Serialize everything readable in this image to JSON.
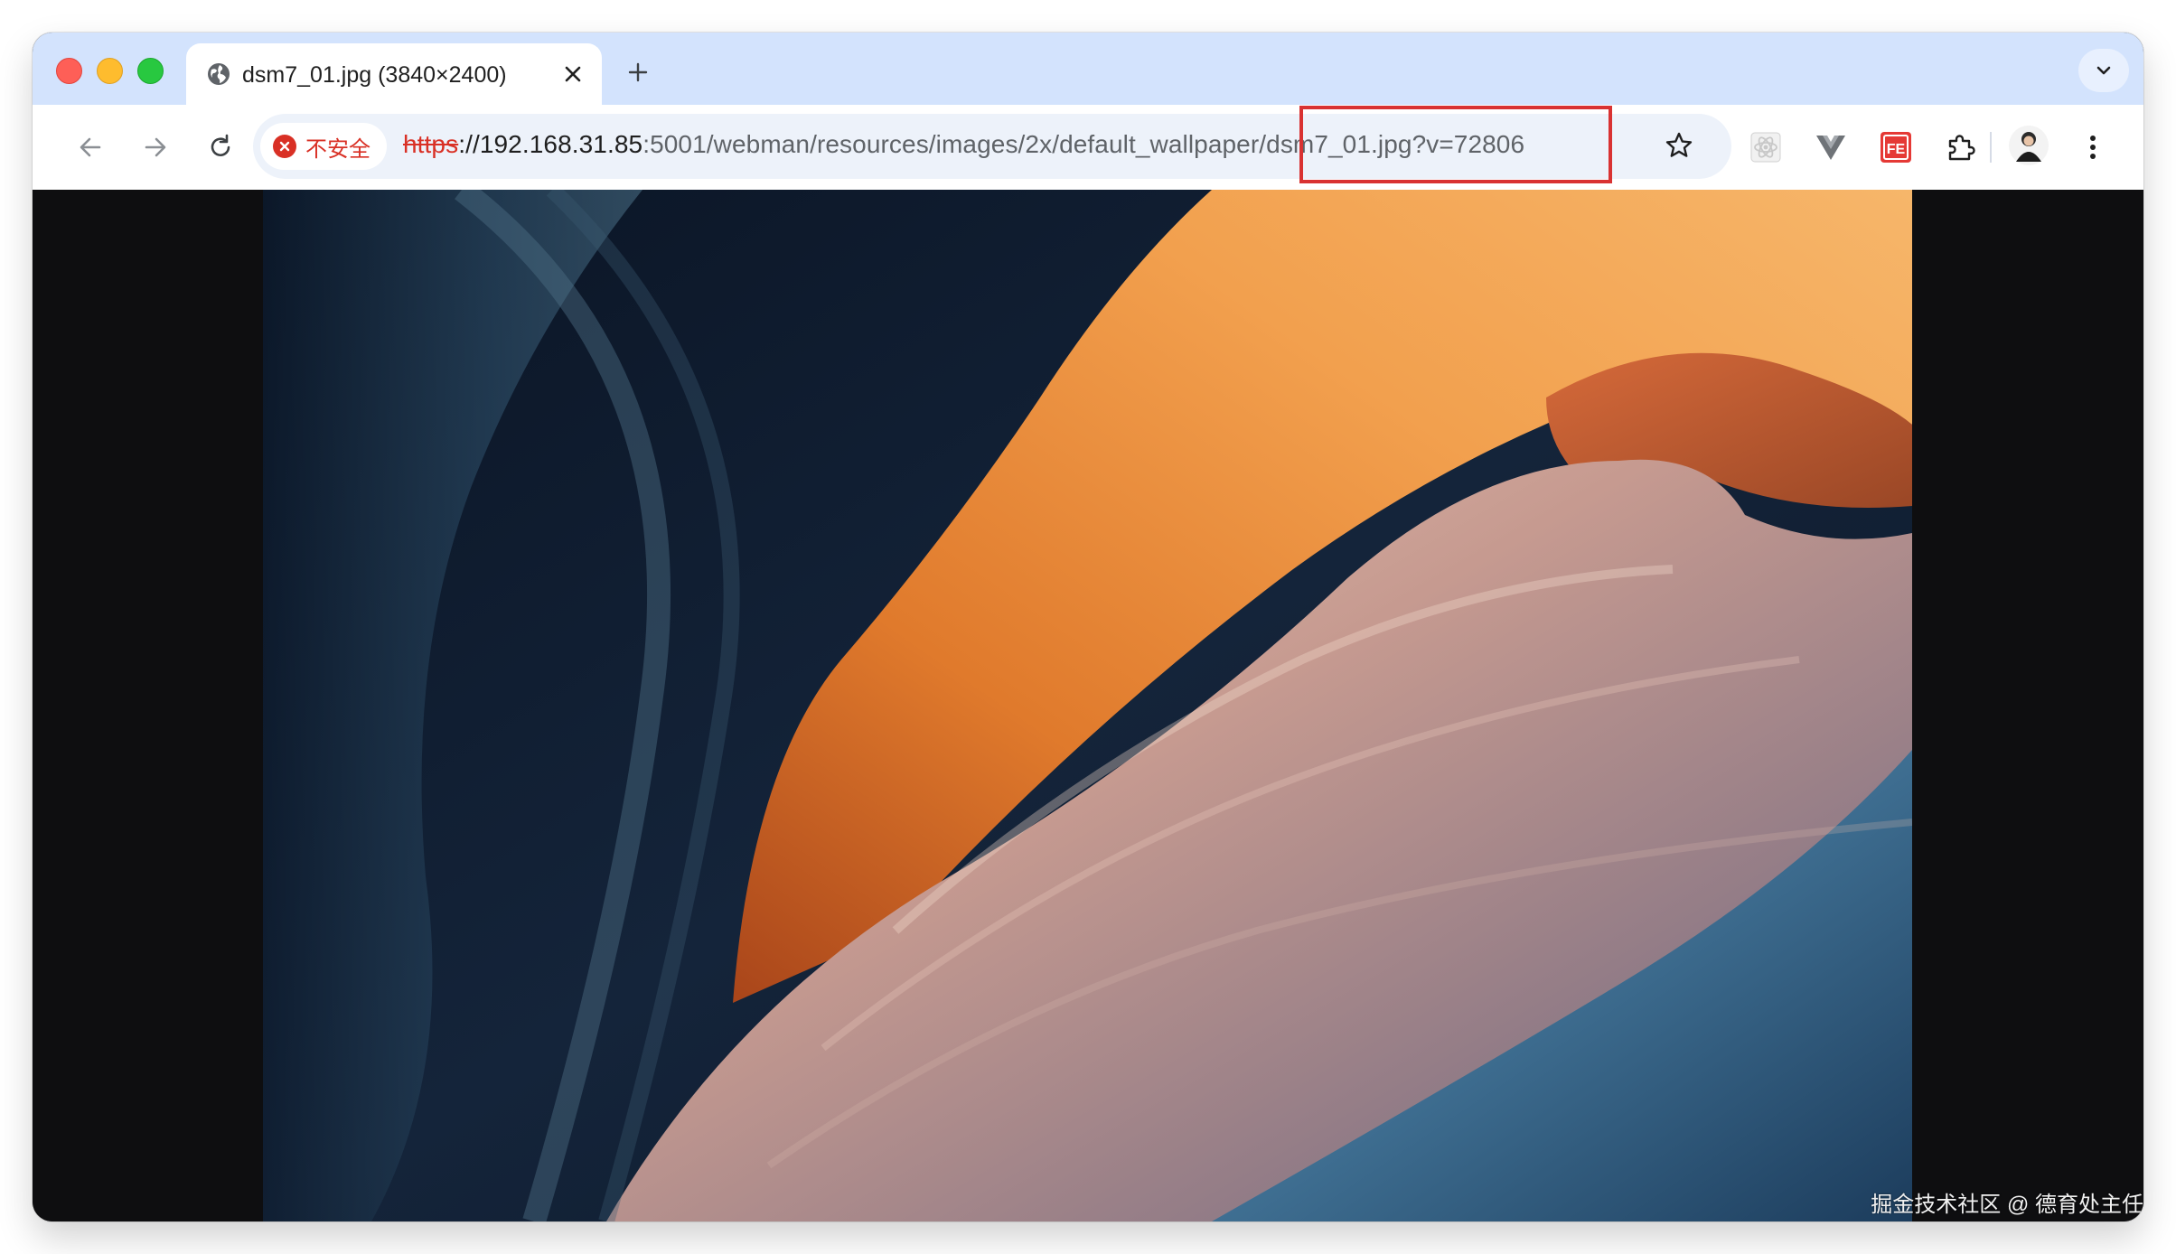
{
  "tab": {
    "title": "dsm7_01.jpg (3840×2400)",
    "icon": "globe-icon"
  },
  "toolbar": {
    "security_label": "不安全",
    "url_protocol": "https",
    "url_host": "://192.168.31.85",
    "url_rest": ":5001/webman/resources/images/2x/default_wallpaper/dsm7_01.jpg?v=72806"
  },
  "extensions": [
    "react-devtools-icon",
    "vue-devtools-icon",
    "fehelper-icon",
    "extensions-puzzle-icon"
  ],
  "extension_fe_label": "FE",
  "watermark": "掘金技术社区 @ 德育处主任",
  "colors": {
    "tabstrip": "#d3e3fd",
    "omnibox": "#edf2fa",
    "insecure": "#d93025",
    "highlight": "#d93232"
  }
}
